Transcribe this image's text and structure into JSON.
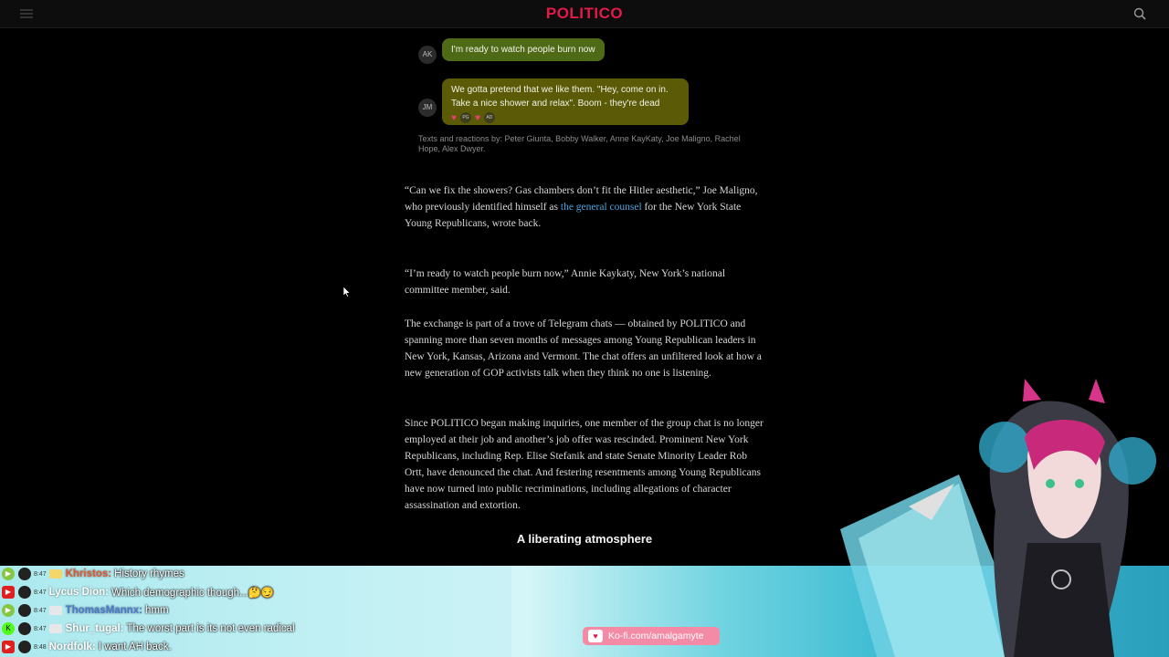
{
  "site": {
    "logo": "POLITICO",
    "brand_color": "#e5194a",
    "menu_icon": "menu-icon",
    "search_icon": "search-icon"
  },
  "chat_screenshot": {
    "messages": [
      {
        "initials": "AK",
        "text": "I'm ready to watch people burn now",
        "bubble_color": "#4e6a17"
      },
      {
        "initials": "JM",
        "text": "We gotta pretend that we like them. \"Hey, come on in. Take a nice shower and relax\". Boom - they're dead",
        "bubble_color": "#5a5a07"
      }
    ],
    "reactions": [
      "heart",
      "PG",
      "heart",
      "AD"
    ],
    "credit": "Texts and reactions by: Peter Giunta, Bobby Walker, Anne KayKaty, Joe Maligno, Rachel Hope, Alex Dwyer."
  },
  "article": {
    "p1_before_link": "“Can we fix the showers? Gas chambers don’t fit the Hitler aesthetic,” Joe Maligno, who previously identified himself as ",
    "p1_link": "the general counsel",
    "p1_after_link": " for the New York State Young Republicans, wrote back.",
    "p2": "“I’m ready to watch people burn now,” Annie Kaykaty, New York’s national committee member, said.",
    "p3": "The exchange is part of a trove of Telegram chats — obtained by POLITICO and spanning more than seven months of messages among Young Republican leaders in New York, Kansas, Arizona and Vermont. The chat offers an unfiltered look at how a new generation of GOP activists talk when they think no one is listening.",
    "p4": "Since POLITICO began making inquiries, one member of the group chat is no longer employed at their job and another’s job offer was rescinded. Prominent New York Republicans, including Rep. Elise Stefanik and state Senate Minority Leader Rob Ortt, have denounced the chat. And festering resentments among Young Republicans have now turned into public recriminations, including allegations of character assassination and extortion.",
    "subheading": "A liberating atmosphere"
  },
  "stream_chat": [
    {
      "platform": "rumble",
      "time": "8:47",
      "badge": "gold",
      "name": "Khristos:",
      "name_color": "#e4572e",
      "text": "History rhymes"
    },
    {
      "platform": "youtube",
      "time": "8:47",
      "badge": "none",
      "name": "Lycus Dion:",
      "name_color": "#ffffff",
      "text": "Which demographic though...🤔😏"
    },
    {
      "platform": "rumble",
      "time": "8:47",
      "badge": "grey",
      "name": "ThomasMannx:",
      "name_color": "#4a7bd0",
      "text": "hmm"
    },
    {
      "platform": "kick",
      "time": "8:47",
      "badge": "grey",
      "name": "Shur_tugal:",
      "name_color": "#ffffff",
      "text": "The worst part is its not even radical"
    },
    {
      "platform": "youtube",
      "time": "8:48",
      "badge": "none",
      "name": "Nordfolk:",
      "name_color": "#ffffff",
      "text": "I want AH back."
    }
  ],
  "kofi": {
    "label": "Ko-fi.com/amalgamyte",
    "icon": "kofi-cup-icon"
  }
}
